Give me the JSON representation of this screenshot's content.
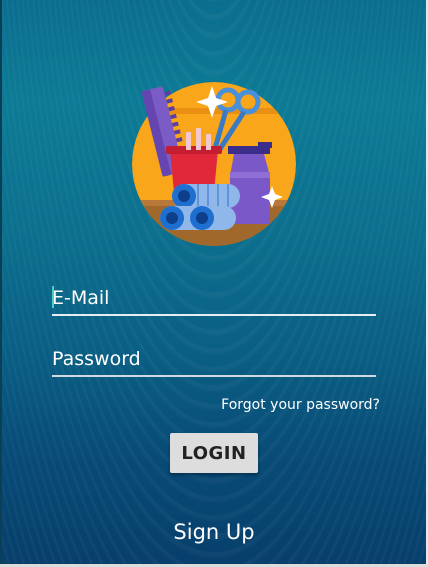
{
  "logo": {
    "icon": "salon-tools-logo",
    "colors": {
      "circle": "#f9a61a",
      "ground": "#a0682a",
      "comb": "#7b5cc7",
      "scissors": "#4a90d9",
      "cup": "#e0283a",
      "rollers": "#1e6fd0",
      "bottle": "#7a58c8",
      "sparkle": "#ffffff"
    }
  },
  "form": {
    "email_placeholder": "E-Mail",
    "password_placeholder": "Password",
    "forgot_label": "Forgot your password?",
    "login_label": "LOGIN",
    "signup_label": "Sign Up"
  },
  "theme": {
    "background_top": "#0d7b96",
    "background_bottom": "#073f6b",
    "caret": "#4ad0c8",
    "button_bg": "#dddddd"
  }
}
